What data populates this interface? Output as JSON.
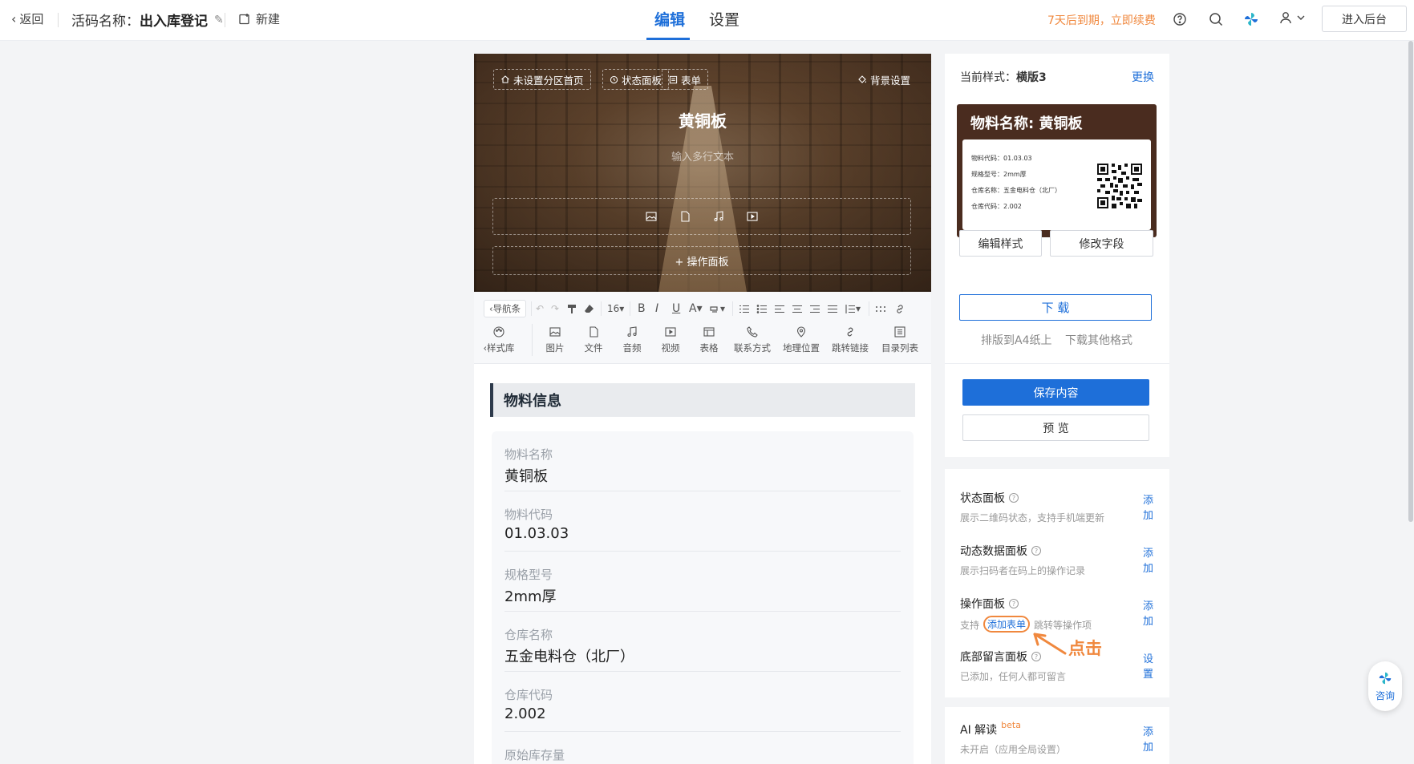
{
  "topbar": {
    "back": "返回",
    "title_prefix": "活码名称：",
    "title_name": "出入库登记",
    "new": "新建",
    "tabs": [
      "编辑",
      "设置"
    ],
    "expire": "7天后到期，立即续费",
    "enter": "进入后台"
  },
  "hero": {
    "chips": [
      "未设置分区首页",
      "状态面板",
      "表单"
    ],
    "bg_setting": "背景设置",
    "title": "黄铜板",
    "placeholder": "输入多行文本",
    "op_panel": "+ 操作面板"
  },
  "toolbar": {
    "nav": "导航条",
    "font_size": "16",
    "style_lib": "样式库",
    "tools": [
      "图片",
      "文件",
      "音频",
      "视频",
      "表格",
      "联系方式",
      "地理位置",
      "跳转链接",
      "目录列表"
    ]
  },
  "content": {
    "section": "物料信息",
    "fields": [
      {
        "label": "物料名称",
        "value": "黄铜板"
      },
      {
        "label": "物料代码",
        "value": "01.03.03"
      },
      {
        "label": "规格型号",
        "value": "2mm厚"
      },
      {
        "label": "仓库名称",
        "value": "五金电料仓（北厂）"
      },
      {
        "label": "仓库代码",
        "value": "2.002"
      },
      {
        "label": "原始库存量",
        "value": ""
      }
    ]
  },
  "right": {
    "style_label": "当前样式：",
    "style_name": "横版3",
    "change": "更换",
    "label": {
      "title": "物料名称: 黄铜板",
      "lines": [
        "物料代码：01.03.03",
        "规格型号：2mm厚",
        "仓库名称：五金电料仓（北厂）",
        "仓库代码：2.002"
      ]
    },
    "edit_style": "编辑样式",
    "edit_fields": "修改字段",
    "download": "下 载",
    "a4": "排版到A4纸上",
    "other": "下载其他格式",
    "save": "保存内容",
    "preview": "预 览",
    "panels": [
      {
        "title": "状态面板",
        "desc": "展示二维码状态，支持手机端更新",
        "action": "添加"
      },
      {
        "title": "动态数据面板",
        "desc": "展示扫码者在码上的操作记录",
        "action": "添加"
      },
      {
        "title": "操作面板",
        "desc_pre": "支持",
        "desc_hl": "添加表单",
        "desc_post": "跳转等操作项",
        "action": "添加"
      },
      {
        "title": "底部留言面板",
        "desc": "已添加，任何人都可留言",
        "action": "设置"
      }
    ],
    "ai": {
      "title": "AI 解读",
      "beta": "beta",
      "desc": "未开启（应用全局设置）",
      "action": "添加"
    },
    "annotation": "点击"
  },
  "consult": "咨询"
}
